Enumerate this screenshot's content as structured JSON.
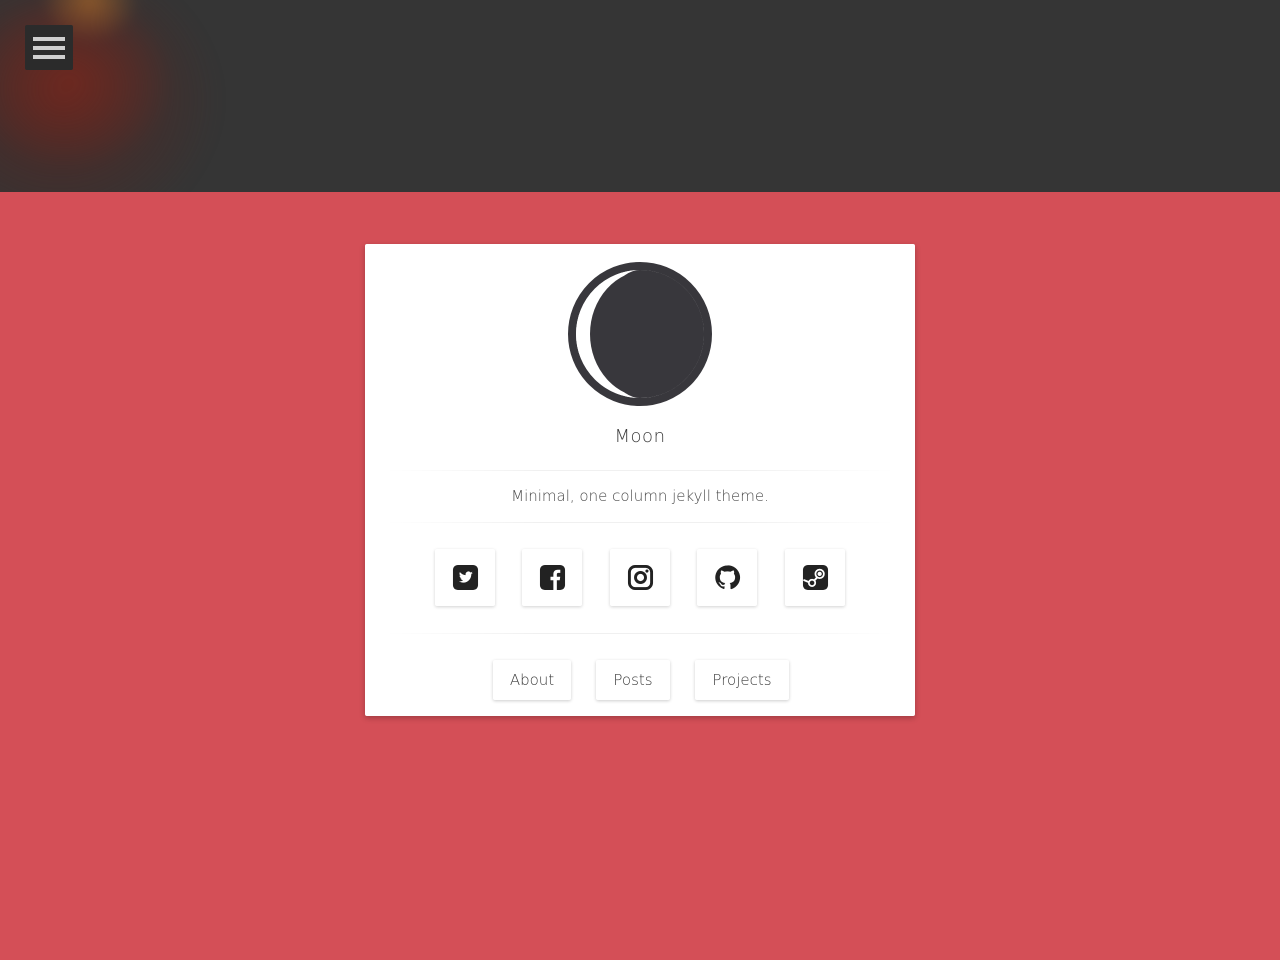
{
  "header": {
    "menu_icon": "hamburger-menu-icon",
    "background_color": "#353535"
  },
  "page": {
    "background_color": "#d44f57"
  },
  "profile": {
    "avatar_icon": "moon-icon",
    "name": "Moon",
    "tagline": "Minimal, one column jekyll theme."
  },
  "social_links": [
    {
      "icon": "twitter-icon"
    },
    {
      "icon": "facebook-icon"
    },
    {
      "icon": "instagram-icon"
    },
    {
      "icon": "github-icon"
    },
    {
      "icon": "steam-icon"
    }
  ],
  "nav": {
    "about": "About",
    "posts": "Posts",
    "projects": "Projects"
  }
}
